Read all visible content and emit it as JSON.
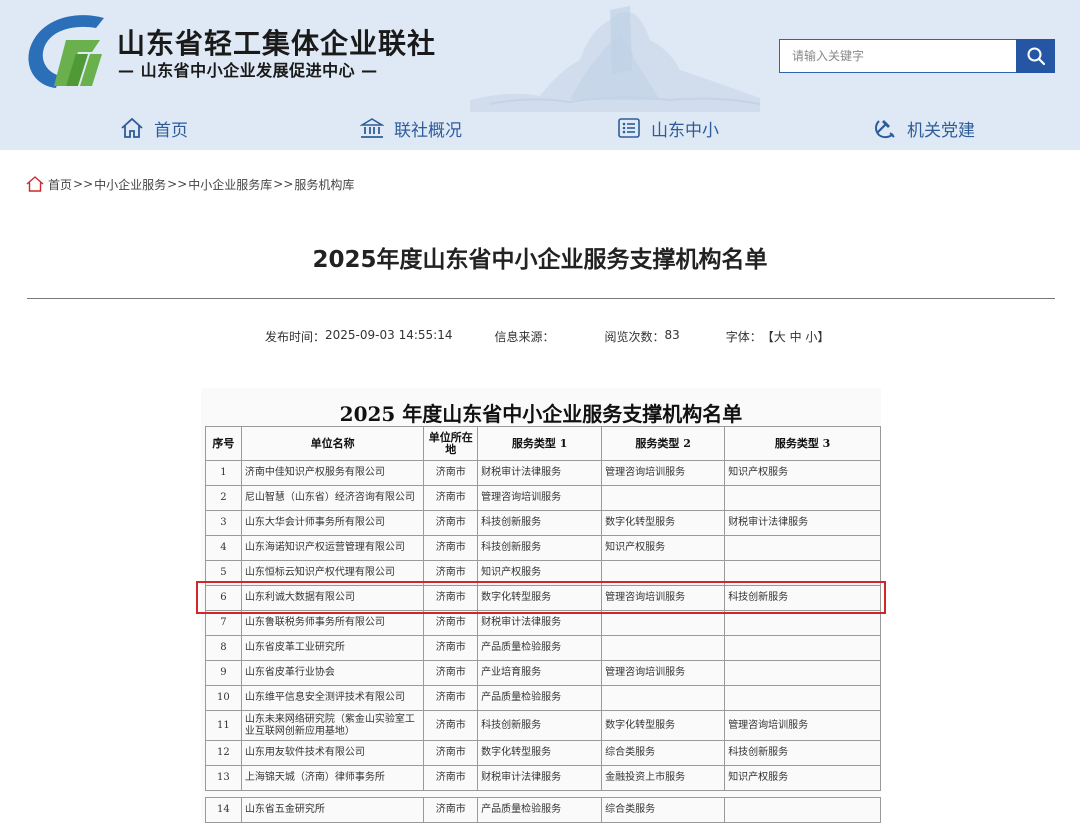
{
  "header": {
    "org_name": "山东省轻工集体企业联社",
    "org_sub": "— 山东省中小企业发展促进中心 —",
    "search": {
      "placeholder": "请输入关键字"
    },
    "colors": {
      "band": "#dfe9f5",
      "nav_text": "#2e5c99",
      "search_btn": "#2456a3"
    }
  },
  "nav": [
    {
      "label": "首页",
      "icon": "home-icon"
    },
    {
      "label": "联社概况",
      "icon": "institution-icon"
    },
    {
      "label": "山东中小",
      "icon": "list-icon"
    },
    {
      "label": "机关党建",
      "icon": "party-emblem-icon"
    }
  ],
  "breadcrumb": {
    "icon": "home-outline-icon",
    "items": [
      "首页",
      "中小企业服务",
      "中小企业服务库",
      "服务机构库"
    ],
    "separator": ">>"
  },
  "article": {
    "title": "2025年度山东省中小企业服务支撑机构名单",
    "meta": {
      "publish_label": "发布时间：",
      "publish_time": "2025-09-03 14:55:14",
      "source_label": "信息来源：",
      "source_value": "",
      "views_label": "阅览次数：",
      "views_value": "83",
      "font_label": "字体：",
      "font_controls": "【大 中 小】"
    }
  },
  "document": {
    "title": "2025 年度山东省中小企业服务支撑机构名单",
    "highlight_color": "#d0272c",
    "highlighted_row": "6",
    "headers": [
      "序号",
      "单位名称",
      "单位所在地",
      "服务类型 1",
      "服务类型 2",
      "服务类型 3"
    ],
    "rows": [
      [
        "1",
        "济南中佳知识产权服务有限公司",
        "济南市",
        "财税审计法律服务",
        "管理咨询培训服务",
        "知识产权服务"
      ],
      [
        "2",
        "尼山智慧（山东省）经济咨询有限公司",
        "济南市",
        "管理咨询培训服务",
        "",
        ""
      ],
      [
        "3",
        "山东大华会计师事务所有限公司",
        "济南市",
        "科技创新服务",
        "数字化转型服务",
        "财税审计法律服务"
      ],
      [
        "4",
        "山东海诺知识产权运营管理有限公司",
        "济南市",
        "科技创新服务",
        "知识产权服务",
        ""
      ],
      [
        "5",
        "山东恒标云知识产权代理有限公司",
        "济南市",
        "知识产权服务",
        "",
        ""
      ],
      [
        "6",
        "山东利诚大数据有限公司",
        "济南市",
        "数字化转型服务",
        "管理咨询培训服务",
        "科技创新服务"
      ],
      [
        "7",
        "山东鲁联税务师事务所有限公司",
        "济南市",
        "财税审计法律服务",
        "",
        ""
      ],
      [
        "8",
        "山东省皮革工业研究所",
        "济南市",
        "产品质量检验服务",
        "",
        ""
      ],
      [
        "9",
        "山东省皮革行业协会",
        "济南市",
        "产业培育服务",
        "管理咨询培训服务",
        ""
      ],
      [
        "10",
        "山东维平信息安全测评技术有限公司",
        "济南市",
        "产品质量检验服务",
        "",
        ""
      ],
      [
        "11",
        "山东未来网络研究院（紫金山实验室工业互联网创新应用基地）",
        "济南市",
        "科技创新服务",
        "数字化转型服务",
        "管理咨询培训服务"
      ],
      [
        "12",
        "山东用友软件技术有限公司",
        "济南市",
        "数字化转型服务",
        "综合类服务",
        "科技创新服务"
      ],
      [
        "13",
        "上海锦天城（济南）律师事务所",
        "济南市",
        "财税审计法律服务",
        "金融投资上市服务",
        "知识产权服务"
      ],
      [
        "14",
        "山东省五金研究所",
        "济南市",
        "产品质量检验服务",
        "综合类服务",
        ""
      ]
    ]
  }
}
